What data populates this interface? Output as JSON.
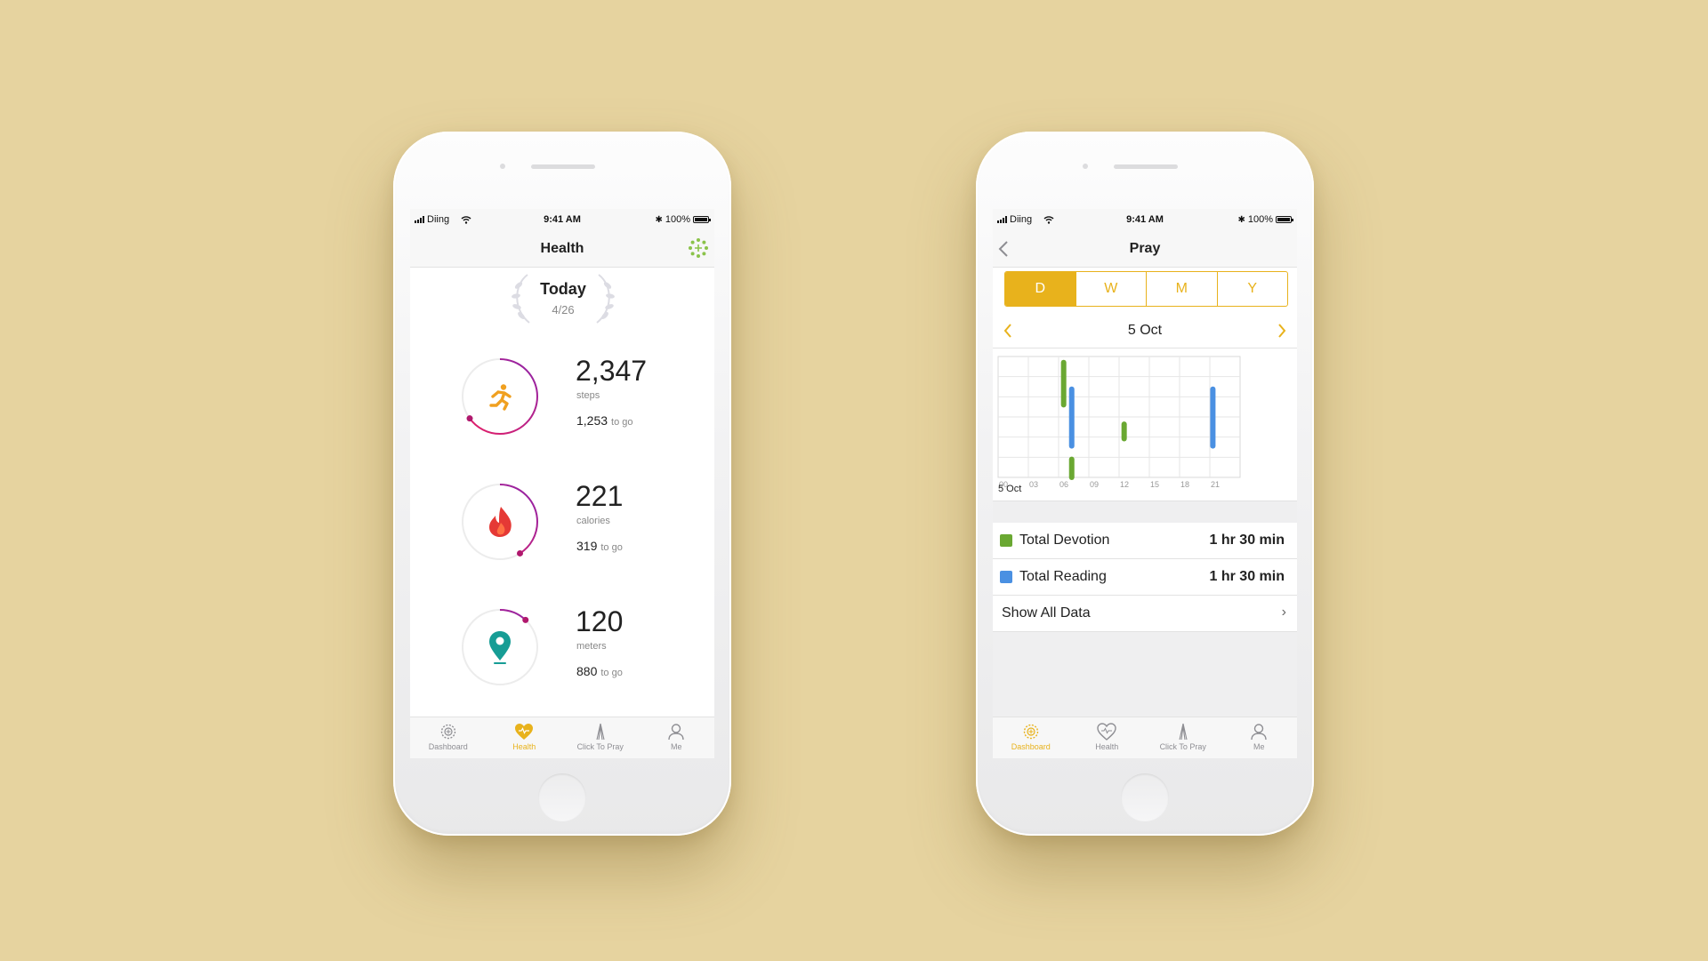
{
  "colors": {
    "background": "#e6d39f",
    "accent": "#e8b21c",
    "green": "#6aa832",
    "blue": "#4a90e2",
    "ring_gradient": [
      "#8e24aa",
      "#e91e63"
    ]
  },
  "status_bar": {
    "carrier": "Diing",
    "time": "9:41 AM",
    "battery": "100%"
  },
  "tabs": [
    {
      "label": "Dashboard",
      "icon": "dashboard-icon"
    },
    {
      "label": "Health",
      "icon": "heart-icon"
    },
    {
      "label": "Click To Pray",
      "icon": "pray-icon"
    },
    {
      "label": "Me",
      "icon": "person-icon"
    }
  ],
  "health_screen": {
    "title": "Health",
    "today_label": "Today",
    "today_date": "4/26",
    "active_tab": "Health",
    "metrics": [
      {
        "value": "2,347",
        "unit": "steps",
        "to_go_value": "1,253",
        "to_go_label": "to go",
        "icon": "running-icon",
        "progress": 0.65
      },
      {
        "value": "221",
        "unit": "calories",
        "to_go_value": "319",
        "to_go_label": "to go",
        "icon": "flame-icon",
        "progress": 0.41
      },
      {
        "value": "120",
        "unit": "meters",
        "to_go_value": "880",
        "to_go_label": "to go",
        "icon": "location-pin-icon",
        "progress": 0.12
      }
    ]
  },
  "pray_screen": {
    "title": "Pray",
    "active_tab": "Dashboard",
    "segments": [
      "D",
      "W",
      "M",
      "Y"
    ],
    "selected_segment": "D",
    "date_label": "5 Oct",
    "chart_date_label": "5 Oct",
    "rows": [
      {
        "label": "Total Devotion",
        "value": "1 hr 30 min",
        "color": "#6aa832"
      },
      {
        "label": "Total Reading",
        "value": "1 hr 30 min",
        "color": "#4a90e2"
      }
    ],
    "show_all": "Show All Data"
  },
  "chart_data": {
    "type": "bar",
    "x_ticks": [
      "00",
      "03",
      "06",
      "09",
      "12",
      "15",
      "18",
      "21"
    ],
    "xlim": [
      0,
      24
    ],
    "grid": true,
    "series": [
      {
        "name": "Total Devotion",
        "color": "#6aa832",
        "bars": [
          {
            "hour": 6.5,
            "from": 0.95,
            "to": 0.6
          },
          {
            "hour": 12.5,
            "from": 0.44,
            "to": 0.32
          },
          {
            "hour": 7.3,
            "from": 0.15,
            "to": 0.0
          }
        ]
      },
      {
        "name": "Total Reading",
        "color": "#4a90e2",
        "bars": [
          {
            "hour": 7.3,
            "from": 0.73,
            "to": 0.26
          },
          {
            "hour": 21.3,
            "from": 0.73,
            "to": 0.26
          }
        ]
      }
    ]
  }
}
